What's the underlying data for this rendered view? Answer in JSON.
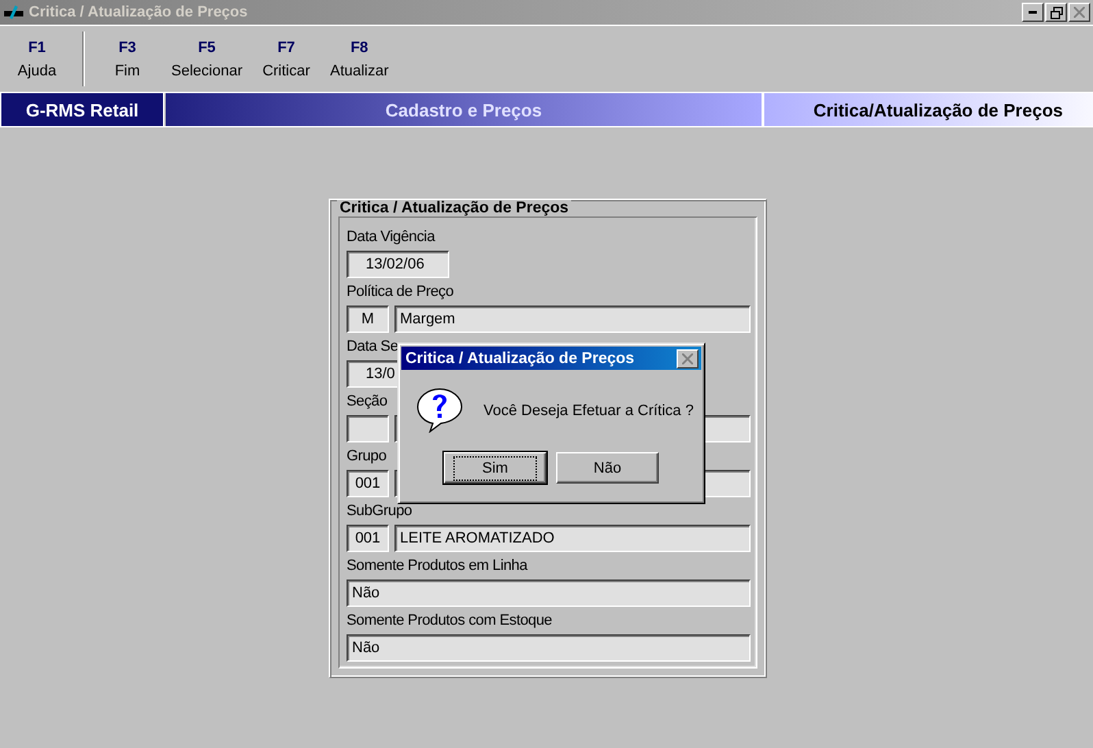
{
  "window": {
    "title": "Critica / Atualização de Preços",
    "active": false
  },
  "toolbar": [
    {
      "key": "F1",
      "label": "Ajuda",
      "separator_after": true
    },
    {
      "key": "F3",
      "label": "Fim",
      "separator_after": false
    },
    {
      "key": "F5",
      "label": "Selecionar",
      "separator_after": false
    },
    {
      "key": "F7",
      "label": "Criticar",
      "separator_after": false
    },
    {
      "key": "F8",
      "label": "Atualizar",
      "separator_after": false
    }
  ],
  "banner": {
    "system": "G-RMS Retail",
    "module": "Cadastro e Preços",
    "screen": "Critica/Atualização de Preços"
  },
  "form": {
    "title": "Critica / Atualização de Preços",
    "fields": [
      {
        "label": "Data Vigência",
        "kind": "date",
        "value": "13/02/06"
      },
      {
        "label": "Política de Preço",
        "kind": "pair",
        "code": "M",
        "value": "Margem"
      },
      {
        "label": "Data Se",
        "kind": "date",
        "value": "13/0"
      },
      {
        "label": "Seção",
        "kind": "pair"
      },
      {
        "label": "Grupo",
        "kind": "pair",
        "code": "001"
      },
      {
        "label": "SubGrupo",
        "kind": "pair",
        "code": "001",
        "value": "LEITE AROMATIZADO"
      },
      {
        "label": "Somente Produtos em Linha",
        "kind": "wide",
        "value": "Não"
      },
      {
        "label": "Somente Produtos com Estoque",
        "kind": "wide",
        "value": "Não"
      }
    ]
  },
  "dialog": {
    "title": "Critica / Atualização de Preços",
    "message": "Você Deseja Efetuar a Crítica ?",
    "buttons": [
      {
        "label": "Sim",
        "focused": true
      },
      {
        "label": "Não",
        "focused": false
      }
    ]
  }
}
